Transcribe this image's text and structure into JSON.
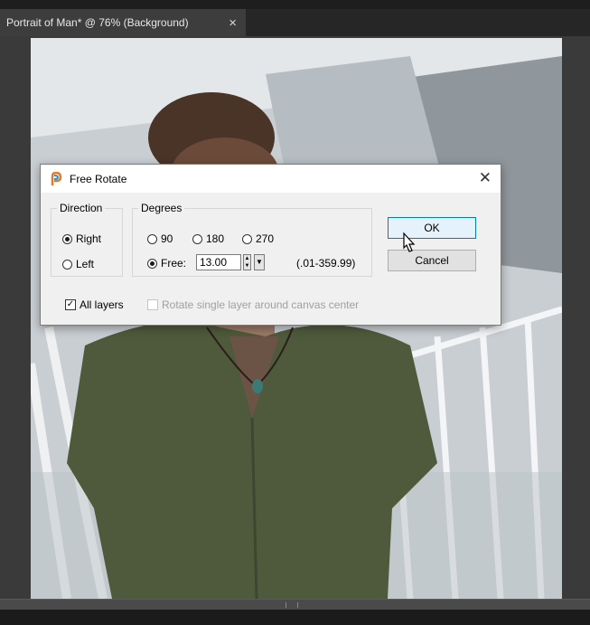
{
  "app": {
    "document_tab": {
      "title": "Portrait of Man* @  76% (Background)",
      "close_glyph": "×"
    }
  },
  "dialog": {
    "title": "Free Rotate",
    "close_glyph": "✕",
    "direction": {
      "legend": "Direction",
      "options": [
        {
          "label": "Right",
          "selected": true
        },
        {
          "label": "Left",
          "selected": false
        }
      ]
    },
    "degrees": {
      "legend": "Degrees",
      "options": [
        {
          "label": "90",
          "selected": false
        },
        {
          "label": "180",
          "selected": false
        },
        {
          "label": "270",
          "selected": false
        },
        {
          "label": "Free:",
          "selected": true
        }
      ],
      "free_value": "13.00",
      "range_hint": "(.01-359.99)"
    },
    "buttons": {
      "ok": "OK",
      "cancel": "Cancel"
    },
    "options": {
      "all_layers": {
        "label": "All layers",
        "checked": true
      },
      "rotate_single": {
        "label": "Rotate single layer around canvas center",
        "checked": false,
        "enabled": false
      }
    }
  },
  "colors": {
    "accent": "#0078d7",
    "dialog_bg": "#f0f0f0",
    "workspace_bg": "#3a3a3a"
  },
  "icons": [
    "app-logo-icon",
    "close-icon",
    "spin-up-icon",
    "spin-down-icon",
    "dropdown-icon",
    "checkmark-icon",
    "mouse-pointer-icon"
  ]
}
